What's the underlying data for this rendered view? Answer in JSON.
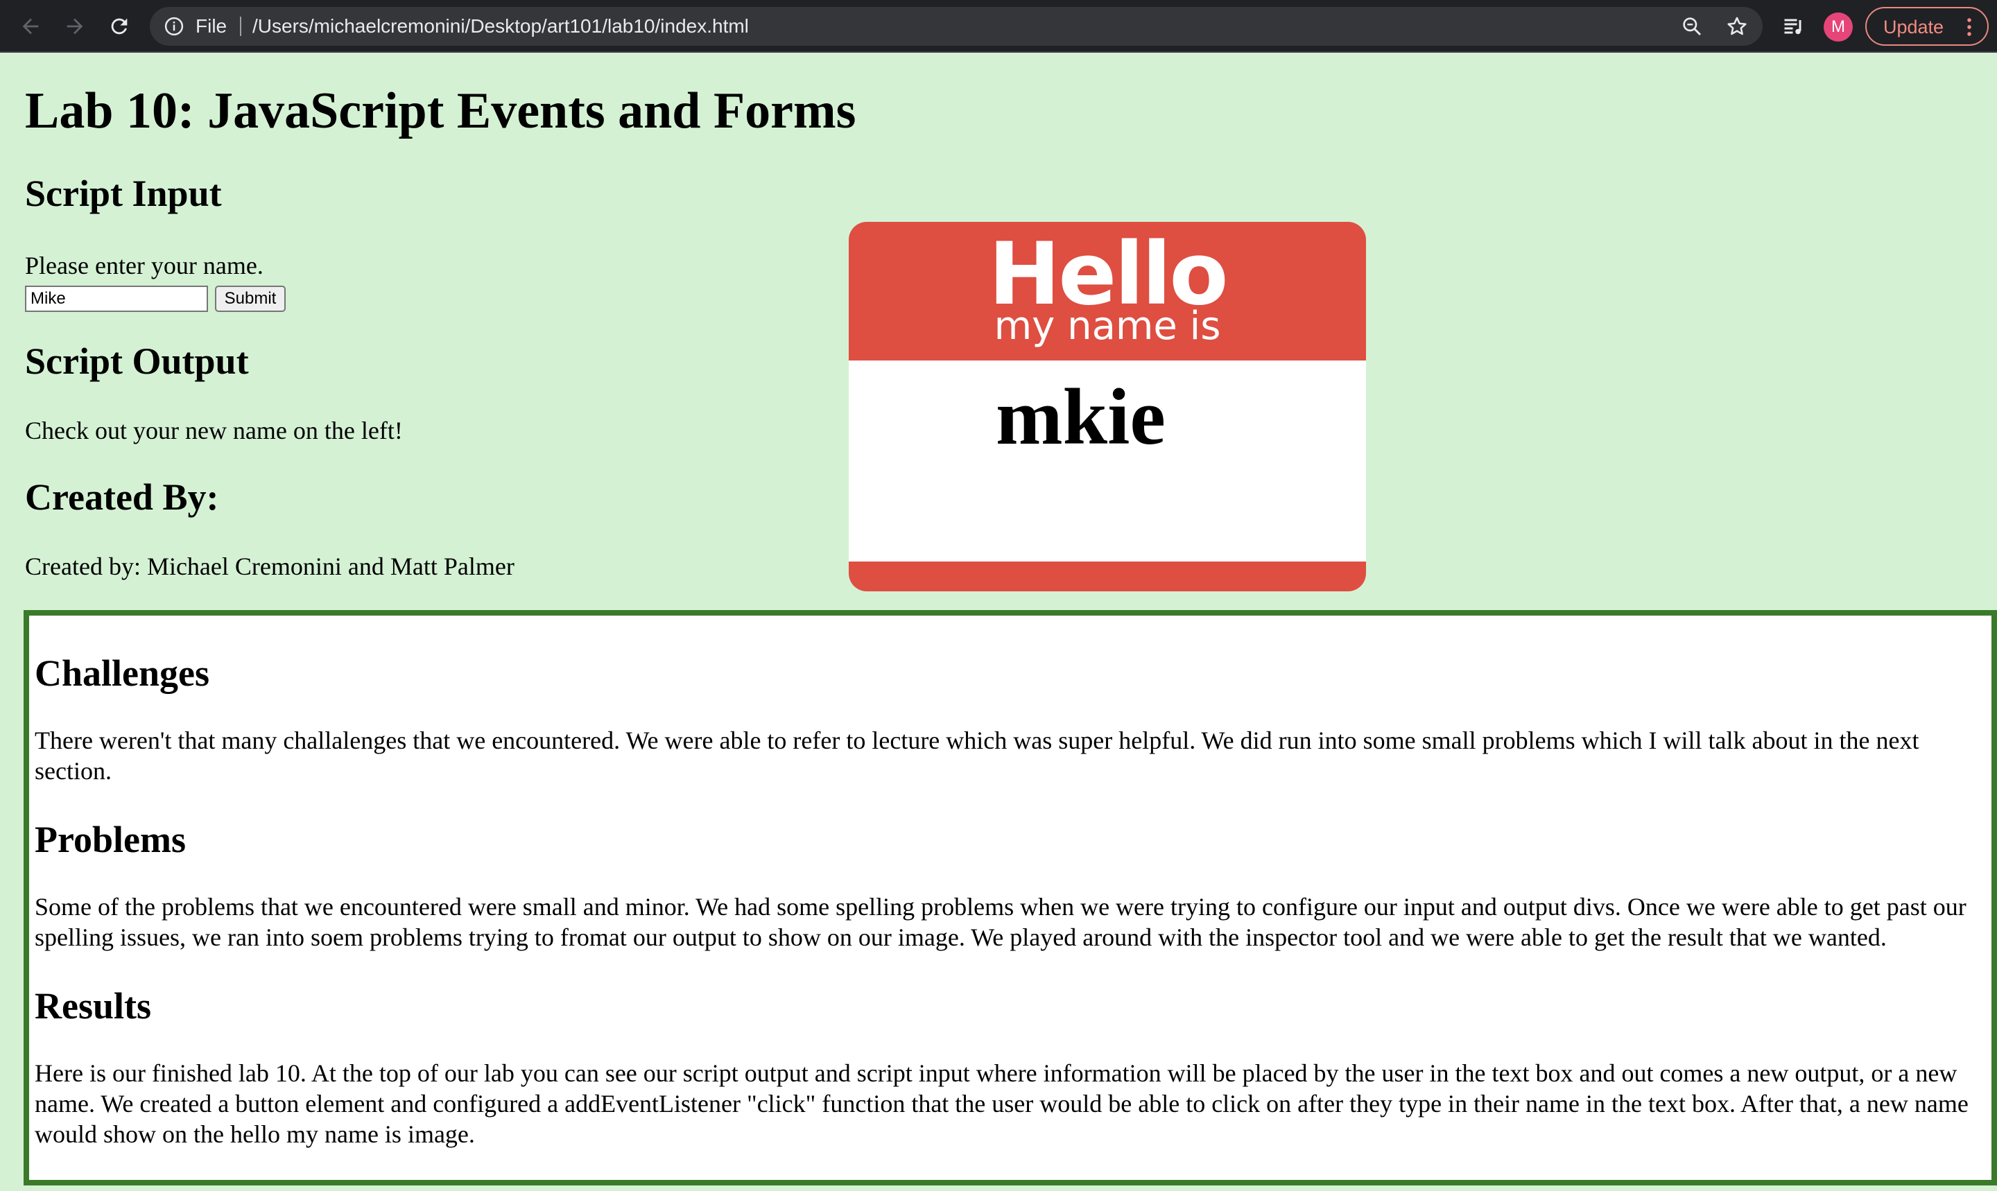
{
  "browser": {
    "scheme_label": "File",
    "url": "/Users/michaelcremonini/Desktop/art101/lab10/index.html",
    "avatar_initial": "M",
    "update_label": "Update",
    "icons": [
      "back-arrow-icon",
      "forward-arrow-icon",
      "reload-icon",
      "info-icon",
      "zoom-icon",
      "star-icon",
      "reading-list-icon",
      "kebab-menu-icon"
    ]
  },
  "page": {
    "title": "Lab 10: JavaScript Events and Forms",
    "input_section": {
      "heading": "Script Input",
      "prompt": "Please enter your name.",
      "input_value": "Mike",
      "submit_label": "Submit"
    },
    "output_section": {
      "heading": "Script Output",
      "text": "Check out your new name on the left!"
    },
    "created_section": {
      "heading": "Created By:",
      "text": "Created by: Michael Cremonini and Matt Palmer"
    },
    "name_tag": {
      "hello": "Hello",
      "my_name_is": "my name is",
      "output_name": "mkie"
    }
  },
  "report": {
    "challenges": {
      "heading": "Challenges",
      "text": "There weren't that many challalenges that we encountered. We were able to refer to lecture which was super helpful. We did run into some small problems which I will talk about in the next section."
    },
    "problems": {
      "heading": "Problems",
      "text": "Some of the problems that we encountered were small and minor. We had some spelling problems when we were trying to configure our input and output divs. Once we were able to get past our spelling issues, we ran into soem problems trying to fromat our output to show on our image. We played around with the inspector tool and we were able to get the result that we wanted."
    },
    "results": {
      "heading": "Results",
      "text": "Here is our finished lab 10. At the top of our lab you can see our script output and script input where information will be placed by the user in the text box and out comes a new output, or a new name. We created a button element and configured a addEventListener \"click\" function that the user would be able to click on after they type in their name in the text box. After that, a new name would show on the hello my name is image."
    }
  },
  "colors": {
    "page_background": "#d4f1d4",
    "name_tag_red": "#de4e41",
    "report_border": "#3a7a2a",
    "browser_chrome": "#202124"
  }
}
